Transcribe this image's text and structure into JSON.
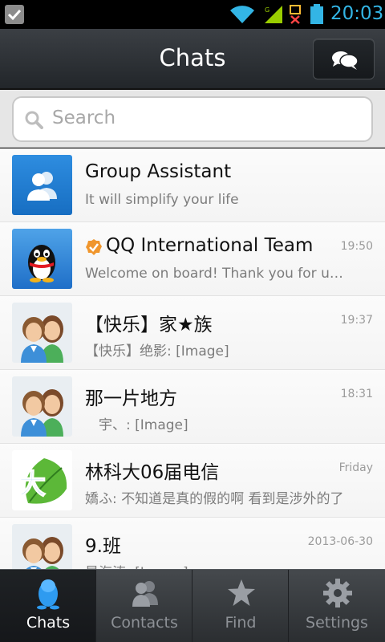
{
  "status_bar": {
    "time": "20:03",
    "icons": [
      "notification-check-icon",
      "wifi-icon",
      "signal-icon",
      "no-sim-icon",
      "battery-icon"
    ],
    "accent_color": "#33b5e5"
  },
  "header": {
    "title": "Chats",
    "compose_icon": "chat-bubbles-icon"
  },
  "search": {
    "placeholder": "Search",
    "icon": "search-icon"
  },
  "chats": [
    {
      "name": "Group Assistant",
      "time": "",
      "message": "It will simplify your life",
      "avatar": "group-assistant-avatar"
    },
    {
      "name": "QQ International Team",
      "time": "19:50",
      "message": "Welcome on board! Thank you for using QQ",
      "avatar": "penguin-avatar",
      "verified": true
    },
    {
      "name": "【快乐】家★族",
      "time": "19:37",
      "message": "【快乐】绝影: [Image]",
      "avatar": "group-couple-avatar"
    },
    {
      "name": "那一片地方",
      "time": "18:31",
      "message": "　宇、: [Image]",
      "avatar": "group-couple-avatar"
    },
    {
      "name": "林科大06届电信",
      "time": "Friday",
      "message": "嬌ふ: 不知道是真的假的啊 看到是涉外的了",
      "avatar": "leaf-logo-avatar"
    },
    {
      "name": "9.班",
      "time": "2013-06-30",
      "message": "是海涛: [Image]",
      "avatar": "group-couple-avatar"
    }
  ],
  "tabs": [
    {
      "label": "Chats",
      "icon": "qq-penguin-icon",
      "active": true
    },
    {
      "label": "Contacts",
      "icon": "contacts-icon",
      "active": false
    },
    {
      "label": "Find",
      "icon": "star-icon",
      "active": false
    },
    {
      "label": "Settings",
      "icon": "gear-icon",
      "active": false
    }
  ]
}
